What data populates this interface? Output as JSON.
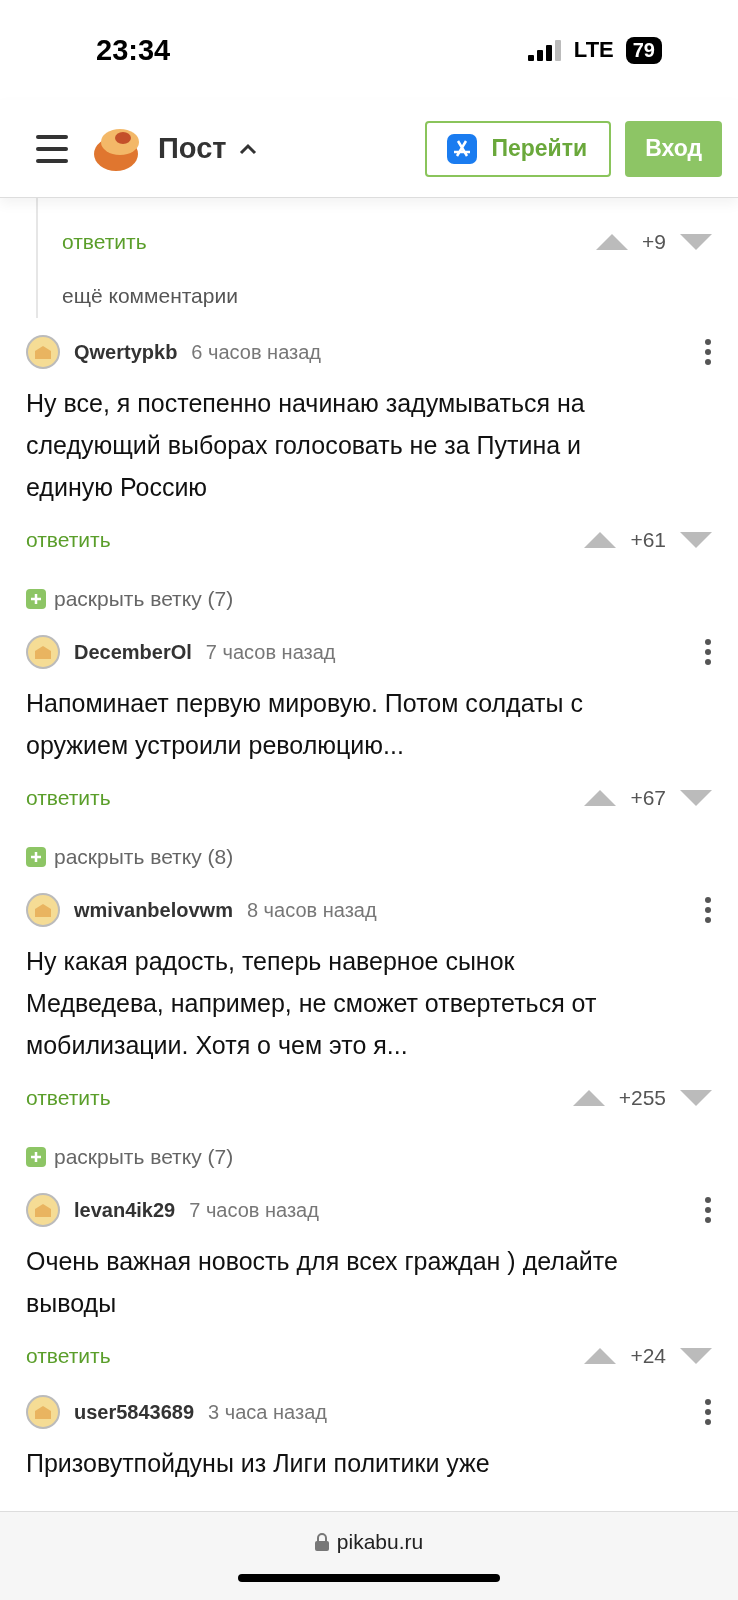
{
  "status_bar": {
    "time": "23:34",
    "network": "LTE",
    "battery": "79"
  },
  "header": {
    "title": "Пост",
    "open_app_button": "Перейти",
    "login_button": "Вход"
  },
  "thread_tail": {
    "reply": "ответить",
    "score": "+9",
    "more": "ещё комментарии"
  },
  "comments": [
    {
      "author": "Qwertypkb",
      "time": "6 часов назад",
      "text": "Ну все, я постепенно начинаю задумываться на следующий выборах голосовать не за Путина и единую Россию",
      "reply": "ответить",
      "score": "+61",
      "expand": "раскрыть ветку (7)"
    },
    {
      "author": "DecemberOl",
      "time": "7 часов назад",
      "text": "Напоминает первую мировую. Потом солдаты с оружием устроили революцию...",
      "reply": "ответить",
      "score": "+67",
      "expand": "раскрыть ветку (8)"
    },
    {
      "author": "wmivanbelovwm",
      "time": "8 часов назад",
      "text": "Ну какая радость, теперь наверное сынок Медведева, например, не сможет отвертеться от мобилизации. Хотя о чем это я...",
      "reply": "ответить",
      "score": "+255",
      "expand": "раскрыть ветку (7)"
    },
    {
      "author": "levan4ik29",
      "time": "7 часов назад",
      "text": "Очень важная новость для всех граждан ) делайте выводы",
      "reply": "ответить",
      "score": "+24"
    },
    {
      "author": "user5843689",
      "time": "3 часа назад",
      "text": "Призовутпойдуны из Лиги политики уже"
    }
  ],
  "browser_bar": {
    "url": "pikabu.ru"
  }
}
